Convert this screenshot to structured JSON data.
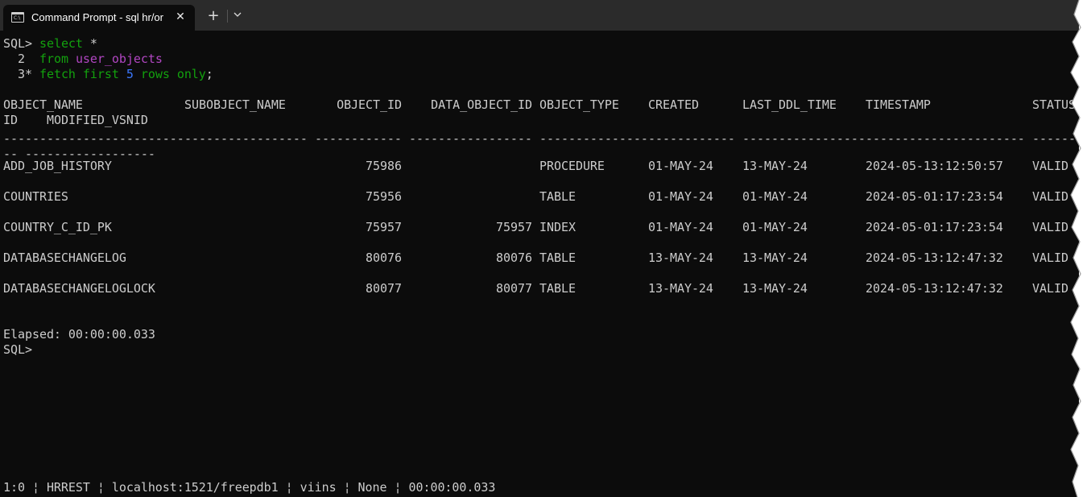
{
  "tab": {
    "title": "Command Prompt - sql  hr/or",
    "close": "✕",
    "new_tab": "+",
    "dropdown": "⌄"
  },
  "query": {
    "prompt": "SQL>",
    "line1": {
      "kw": "select",
      "rest": " *"
    },
    "line2": {
      "num": "  2",
      "kw": "from",
      "obj": "user_objects"
    },
    "line3": {
      "num": "  3*",
      "kw1": "fetch first",
      "n": "5",
      "kw2": "rows only",
      "end": ";"
    }
  },
  "headers": {
    "object_name": "OBJECT_NAME",
    "subobject_name": "SUBOBJECT_NAME",
    "object_id": "OBJECT_ID",
    "data_object_id": "DATA_OBJECT_ID",
    "object_type": "OBJECT_TYPE",
    "created": "CREATED",
    "last_ddl_time": "LAST_DDL_TIME",
    "timestamp": "TIMESTAMP",
    "status": "STATUS",
    "wrap_id": "ID",
    "modified_vsnid": "MODIFIED_VSNID"
  },
  "separators": {
    "object_name": "-------------------------",
    "subobject_name": "-----------------",
    "object_id": "------------",
    "data_object_id": "-----------------",
    "object_type": "---------------",
    "created": "------------",
    "last_ddl_time": "-----------------",
    "timestamp": "----------------------",
    "status": "------",
    "wrap": "-- ------------------"
  },
  "rows": [
    {
      "object_name": "ADD_JOB_HISTORY",
      "object_id": "75986",
      "data_object_id": "",
      "object_type": "PROCEDURE",
      "created": "01-MAY-24",
      "last_ddl_time": "13-MAY-24",
      "timestamp": "2024-05-13:12:50:57",
      "status": "VALID"
    },
    {
      "object_name": "COUNTRIES",
      "object_id": "75956",
      "data_object_id": "",
      "object_type": "TABLE",
      "created": "01-MAY-24",
      "last_ddl_time": "01-MAY-24",
      "timestamp": "2024-05-01:17:23:54",
      "status": "VALID"
    },
    {
      "object_name": "COUNTRY_C_ID_PK",
      "object_id": "75957",
      "data_object_id": "75957",
      "object_type": "INDEX",
      "created": "01-MAY-24",
      "last_ddl_time": "01-MAY-24",
      "timestamp": "2024-05-01:17:23:54",
      "status": "VALID"
    },
    {
      "object_name": "DATABASECHANGELOG",
      "object_id": "80076",
      "data_object_id": "80076",
      "object_type": "TABLE",
      "created": "13-MAY-24",
      "last_ddl_time": "13-MAY-24",
      "timestamp": "2024-05-13:12:47:32",
      "status": "VALID"
    },
    {
      "object_name": "DATABASECHANGELOGLOCK",
      "object_id": "80077",
      "data_object_id": "80077",
      "object_type": "TABLE",
      "created": "13-MAY-24",
      "last_ddl_time": "13-MAY-24",
      "timestamp": "2024-05-13:12:47:32",
      "status": "VALID"
    }
  ],
  "elapsed": "Elapsed: 00:00:00.033",
  "final_prompt": "SQL>",
  "status_bar": "1:0 ¦ HRREST ¦ localhost:1521/freepdb1 ¦ viins ¦ None ¦ 00:00:00.033"
}
